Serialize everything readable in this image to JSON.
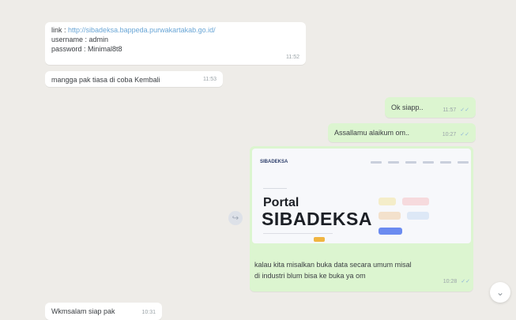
{
  "messages": {
    "credentials": {
      "link_prefix": "link :",
      "link_url": "http://sibadeksa.bappeda.purwakartakab.go.id/",
      "username": "username : admin",
      "password": "password : Minimal8t8",
      "time": "11:52"
    },
    "reply1": {
      "text": "mangga pak tiasa di coba Kembali",
      "time": "11:53"
    },
    "ok": {
      "text": "Ok siapp..",
      "time": "11:57"
    },
    "salam": {
      "text": "Assallamu alaikum om..",
      "time": "10:27"
    },
    "image_message": {
      "caption_line1": "kalau kita misalkan buka data secara umum misal",
      "caption_line2": "di industri blum bisa ke buka ya om",
      "time": "10:28",
      "preview": {
        "brand": "SIBADEKSA",
        "portal": "Portal",
        "title": "SIBADEKSA"
      }
    },
    "wa_salam": {
      "text": "Wkmsalam siap pak",
      "time": "10:31"
    }
  },
  "icons": {
    "double_check": "✓✓",
    "scroll_down": "⌄",
    "forward": "↪"
  },
  "colors": {
    "chat_background": "#eeece8",
    "incoming_bubble": "#ffffff",
    "outgoing_bubble": "#dcf5d0",
    "link": "#6aa6d6"
  }
}
